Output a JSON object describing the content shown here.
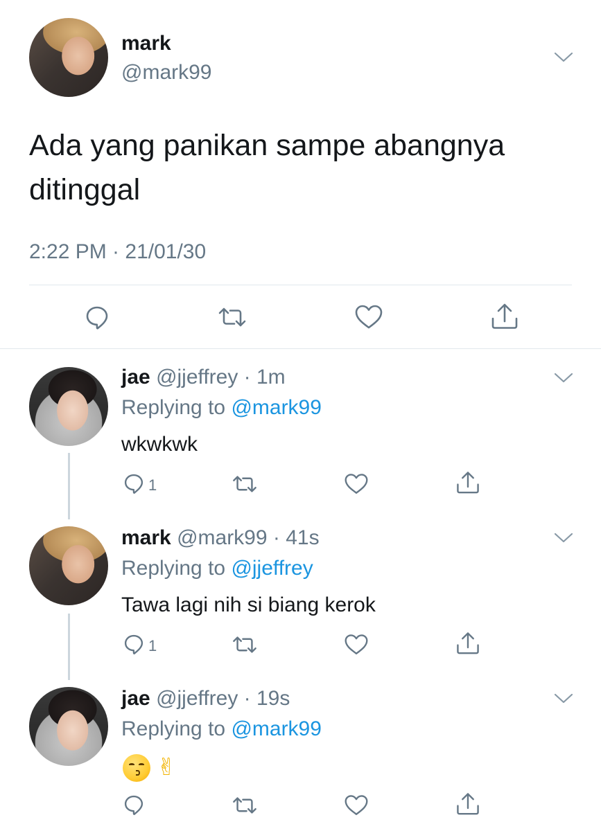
{
  "main_tweet": {
    "name": "mark",
    "handle": "@mark99",
    "text": "Ada yang panikan sampe abangnya ditinggal",
    "timestamp": "2:22 PM · 21/01/30"
  },
  "replies": [
    {
      "name": "jae",
      "handle_time": "@jjeffrey · 1m",
      "replying_prefix": "Replying to ",
      "replying_to": "@mark99",
      "text": "wkwkwk",
      "reply_count": "1"
    },
    {
      "name": "mark",
      "handle_time": "@mark99 · 41s",
      "replying_prefix": "Replying to ",
      "replying_to": "@jjeffrey",
      "text": "Tawa lagi nih si biang kerok",
      "reply_count": "1"
    },
    {
      "name": "jae",
      "handle_time": "@jjeffrey · 19s",
      "replying_prefix": "Replying to ",
      "replying_to": "@mark99",
      "text_emojis": [
        "kissing-face-emoji",
        "victory-hand-emoji"
      ],
      "reply_count": ""
    }
  ],
  "icons": {
    "reply": "reply-icon",
    "retweet": "retweet-icon",
    "like": "heart-icon",
    "share": "share-icon",
    "menu": "chevron-down-icon"
  },
  "colors": {
    "link": "#1b95e0",
    "secondary_text": "#657786",
    "divider": "#e1e8ed",
    "thread_line": "#ccd6dd"
  }
}
